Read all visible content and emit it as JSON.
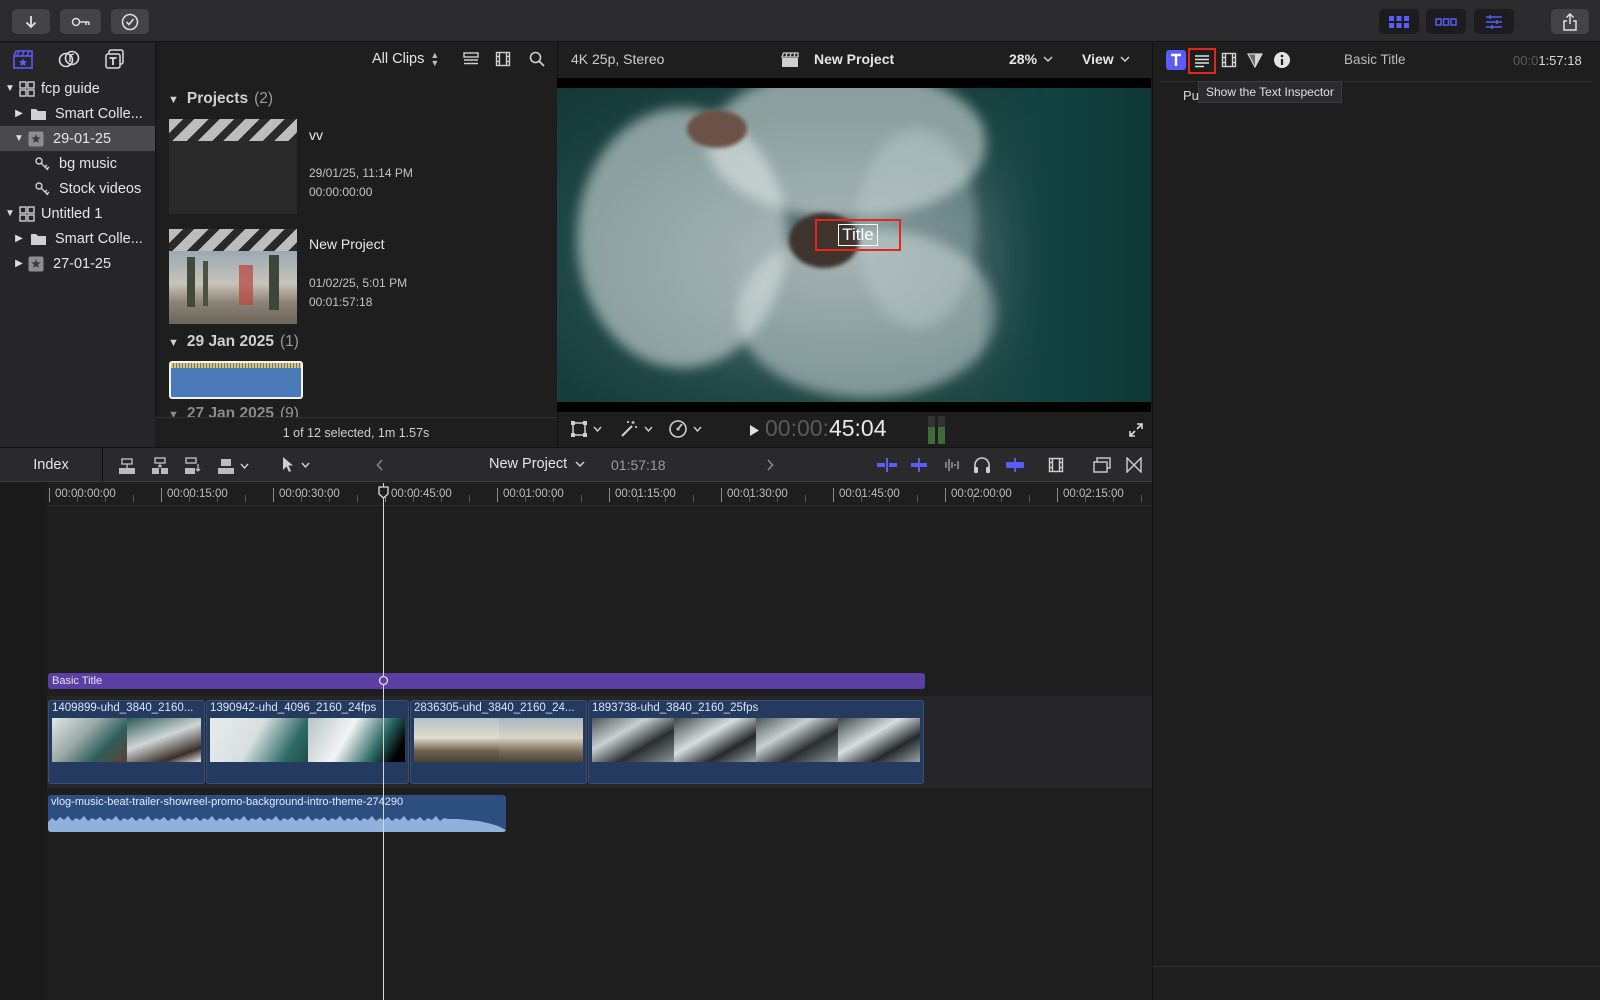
{
  "toolbar": {
    "import_icon": "arrow-down-icon",
    "keywords_icon": "key-icon",
    "background_tasks_icon": "checkmark-circle-icon",
    "share_icon": "share-icon"
  },
  "libraries": {
    "rows": [
      {
        "label": "fcp guide",
        "level": 0,
        "expanded": true,
        "icon": "library-icon"
      },
      {
        "label": "Smart Colle...",
        "level": 1,
        "expanded": false,
        "icon": "folder-icon"
      },
      {
        "label": "29-01-25",
        "level": 1,
        "expanded": true,
        "icon": "event-star-icon",
        "selected": true
      },
      {
        "label": "bg music",
        "level": 2,
        "icon": "keyword-icon"
      },
      {
        "label": "Stock videos",
        "level": 2,
        "icon": "keyword-icon"
      },
      {
        "label": "Untitled 1",
        "level": 0,
        "expanded": true,
        "icon": "library-icon"
      },
      {
        "label": "Smart Colle...",
        "level": 1,
        "expanded": false,
        "icon": "folder-icon"
      },
      {
        "label": "27-01-25",
        "level": 1,
        "expanded": false,
        "icon": "event-star-icon"
      }
    ]
  },
  "browser": {
    "filter_label": "All Clips",
    "projects_section": {
      "title": "Projects",
      "count": "(2)"
    },
    "projects": [
      {
        "name": "vv",
        "date": "29/01/25, 11:14 PM",
        "duration": "00:00:00:00"
      },
      {
        "name": "New Project",
        "date": "01/02/25, 5:01 PM",
        "duration": "00:01:57:18"
      }
    ],
    "date_section": {
      "title": "29 Jan 2025",
      "count": "(1)"
    },
    "partial_section": {
      "title": "27 Jan 2025",
      "count": "(9)"
    },
    "status": "1 of 12 selected, 1m 1.57s"
  },
  "viewer": {
    "format": "4K 25p, Stereo",
    "project_name": "New Project",
    "zoom": "28%",
    "view_label": "View",
    "title_text": "Title",
    "timecode_dim": "00:00:",
    "timecode_bright": "45:04"
  },
  "inspector": {
    "clip_name": "Basic Title",
    "duration_dim": "00:0",
    "duration_bright": "1:57:18",
    "partial_label": "Pu",
    "tooltip": "Show the Text Inspector",
    "accent": "#5b5bf5",
    "highlight": "#e6251b"
  },
  "timeline": {
    "index_label": "Index",
    "project_name": "New Project",
    "duration": "01:57:18",
    "ruler": [
      "00:00:00:00",
      "00:00:15:00",
      "00:00:30:00",
      "00:00:45:00",
      "00:01:00:00",
      "00:01:15:00",
      "00:01:30:00",
      "00:01:45:00",
      "00:02:00:00",
      "00:02:15:00"
    ],
    "title_clip": "Basic Title",
    "video_clips": [
      "1409899-uhd_3840_2160...",
      "1390942-uhd_4096_2160_24fps",
      "2836305-uhd_3840_2160_24...",
      "1893738-uhd_3840_2160_25fps"
    ],
    "audio_clip": "vlog-music-beat-trailer-showreel-promo-background-intro-theme-274290"
  }
}
